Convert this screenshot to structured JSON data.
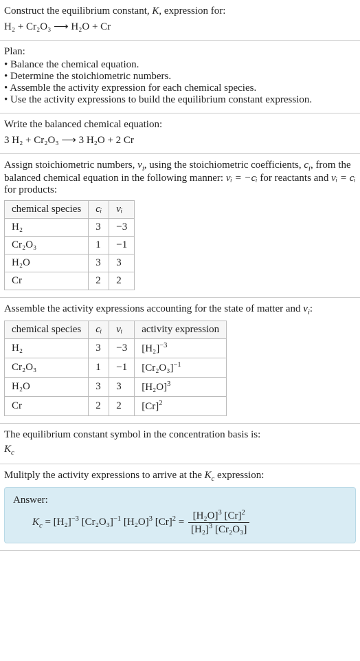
{
  "intro": {
    "line1_pre": "Construct the equilibrium constant, ",
    "line1_k": "K",
    "line1_post": ", expression for:",
    "eq_unbalanced": "H₂ + Cr₂O₃ ⟶ H₂O + Cr"
  },
  "plan": {
    "title": "Plan:",
    "items": [
      "Balance the chemical equation.",
      "Determine the stoichiometric numbers.",
      "Assemble the activity expression for each chemical species.",
      "Use the activity expressions to build the equilibrium constant expression."
    ]
  },
  "balanced": {
    "title": "Write the balanced chemical equation:",
    "eq": "3 H₂ + Cr₂O₃ ⟶ 3 H₂O + 2 Cr"
  },
  "stoich_intro": {
    "pre": "Assign stoichiometric numbers, ",
    "nu": "ν",
    "nu_i": "i",
    "mid1": ", using the stoichiometric coefficients, ",
    "c": "c",
    "c_i": "i",
    "mid2": ", from the balanced chemical equation in the following manner: ",
    "rel_react": "νᵢ = −cᵢ",
    "mid3": " for reactants and ",
    "rel_prod": "νᵢ = cᵢ",
    "post": " for products:"
  },
  "table1": {
    "headers": {
      "species": "chemical species",
      "c": "cᵢ",
      "nu": "νᵢ"
    },
    "rows": [
      {
        "species": "H₂",
        "c": "3",
        "nu": "−3"
      },
      {
        "species": "Cr₂O₃",
        "c": "1",
        "nu": "−1"
      },
      {
        "species": "H₂O",
        "c": "3",
        "nu": "3"
      },
      {
        "species": "Cr",
        "c": "2",
        "nu": "2"
      }
    ]
  },
  "activity_intro": {
    "pre": "Assemble the activity expressions accounting for the state of matter and ",
    "nu": "ν",
    "nu_i": "i",
    "post": ":"
  },
  "table2": {
    "headers": {
      "species": "chemical species",
      "c": "cᵢ",
      "nu": "νᵢ",
      "act": "activity expression"
    },
    "rows": [
      {
        "species": "H₂",
        "c": "3",
        "nu": "−3",
        "base": "[H₂]",
        "exp": "−3"
      },
      {
        "species": "Cr₂O₃",
        "c": "1",
        "nu": "−1",
        "base": "[Cr₂O₃]",
        "exp": "−1"
      },
      {
        "species": "H₂O",
        "c": "3",
        "nu": "3",
        "base": "[H₂O]",
        "exp": "3"
      },
      {
        "species": "Cr",
        "c": "2",
        "nu": "2",
        "base": "[Cr]",
        "exp": "2"
      }
    ]
  },
  "kc_symbol": {
    "line": "The equilibrium constant symbol in the concentration basis is:",
    "k": "K",
    "k_sub": "c"
  },
  "multiply": {
    "pre": "Mulitply the activity expressions to arrive at the ",
    "k": "K",
    "k_sub": "c",
    "post": " expression:"
  },
  "answer": {
    "label": "Answer:",
    "k": "K",
    "k_sub": "c",
    "equals": " = ",
    "t1_base": "[H₂]",
    "t1_exp": "−3",
    "t2_base": "[Cr₂O₃]",
    "t2_exp": "−1",
    "t3_base": "[H₂O]",
    "t3_exp": "3",
    "t4_base": "[Cr]",
    "t4_exp": "2",
    "frac_eq": " = ",
    "num1_base": "[H₂O]",
    "num1_exp": "3",
    "num2_base": "[Cr]",
    "num2_exp": "2",
    "den1_base": "[H₂]",
    "den1_exp": "3",
    "den2_base": "[Cr₂O₃]"
  }
}
